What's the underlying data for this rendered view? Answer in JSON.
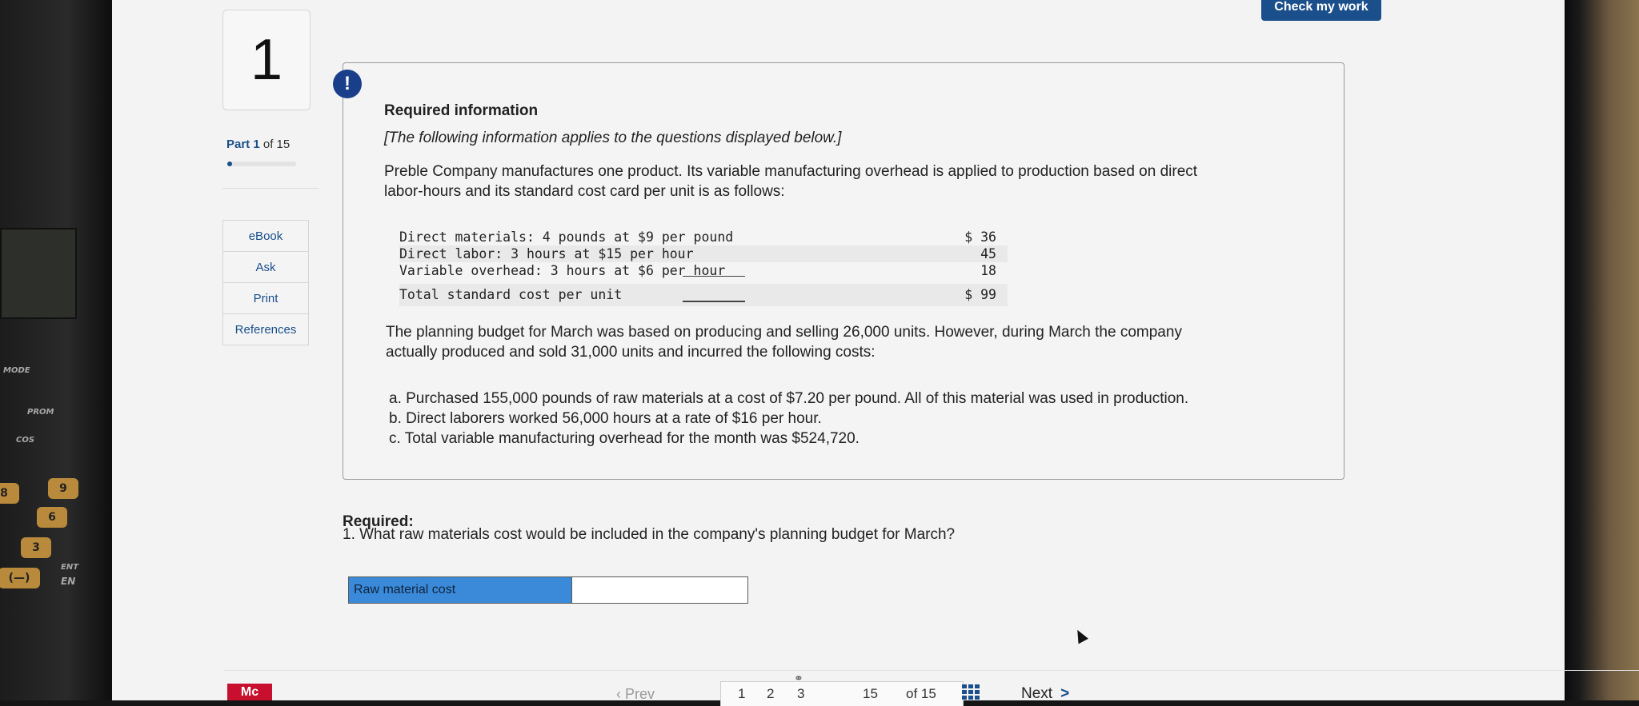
{
  "nav": {
    "question_number": "1",
    "part_label": "Part",
    "part_current": "1",
    "part_total_text": "of 15",
    "part_progress_fraction": 0.067,
    "menu": [
      {
        "label": "eBook"
      },
      {
        "label": "Ask"
      },
      {
        "label": "Print"
      },
      {
        "label": "References"
      }
    ]
  },
  "header": {
    "check_my_work": "Check my work"
  },
  "info": {
    "title": "Required information",
    "note": "[The following information applies to the questions displayed below.]",
    "intro_line1": "Preble Company manufactures one product. Its variable manufacturing overhead is applied to production based on direct",
    "intro_line2": "labor-hours and its standard cost card per unit is as follows:",
    "cost_card": [
      {
        "label": "Direct materials: 4 pounds at $9 per pound",
        "amount": "$ 36"
      },
      {
        "label": "Direct labor: 3 hours at $15 per hour",
        "amount": "45"
      },
      {
        "label": "Variable overhead: 3 hours at $6 per hour",
        "amount": "18"
      },
      {
        "label": "Total standard cost per unit",
        "amount": "$ 99"
      }
    ],
    "budget_line1": "The planning budget for March was based on producing and selling 26,000 units. However, during March the company",
    "budget_line2": "actually produced and sold 31,000 units and incurred the following costs:",
    "costs": [
      "a. Purchased 155,000 pounds of raw materials at a cost of $7.20 per pound. All of this material was used in production.",
      "b. Direct laborers worked 56,000 hours at a rate of $16 per hour.",
      "c. Total variable manufacturing overhead for the month was $524,720."
    ]
  },
  "required": {
    "heading": "Required:",
    "question": "1. What raw materials cost would be included in the company's planning budget for March?",
    "answer_label": "Raw material cost",
    "answer_value": ""
  },
  "pager": {
    "prev": "Prev",
    "pages": [
      "1",
      "2",
      "3",
      "15"
    ],
    "of_total": "of 15",
    "next": "Next"
  },
  "brand": {
    "logo": "Mc"
  },
  "calculator": {
    "keys": [
      "8",
      "9",
      "6",
      "3",
      "(—)"
    ],
    "labels": [
      "MODE",
      "PROM",
      "COS",
      "ENT",
      "EN"
    ]
  },
  "colors": {
    "accent": "#1a4f8b",
    "answer_label_bg": "#3a8ad9",
    "brand_red": "#c8102e",
    "alert_blue": "#1a3f8a"
  }
}
